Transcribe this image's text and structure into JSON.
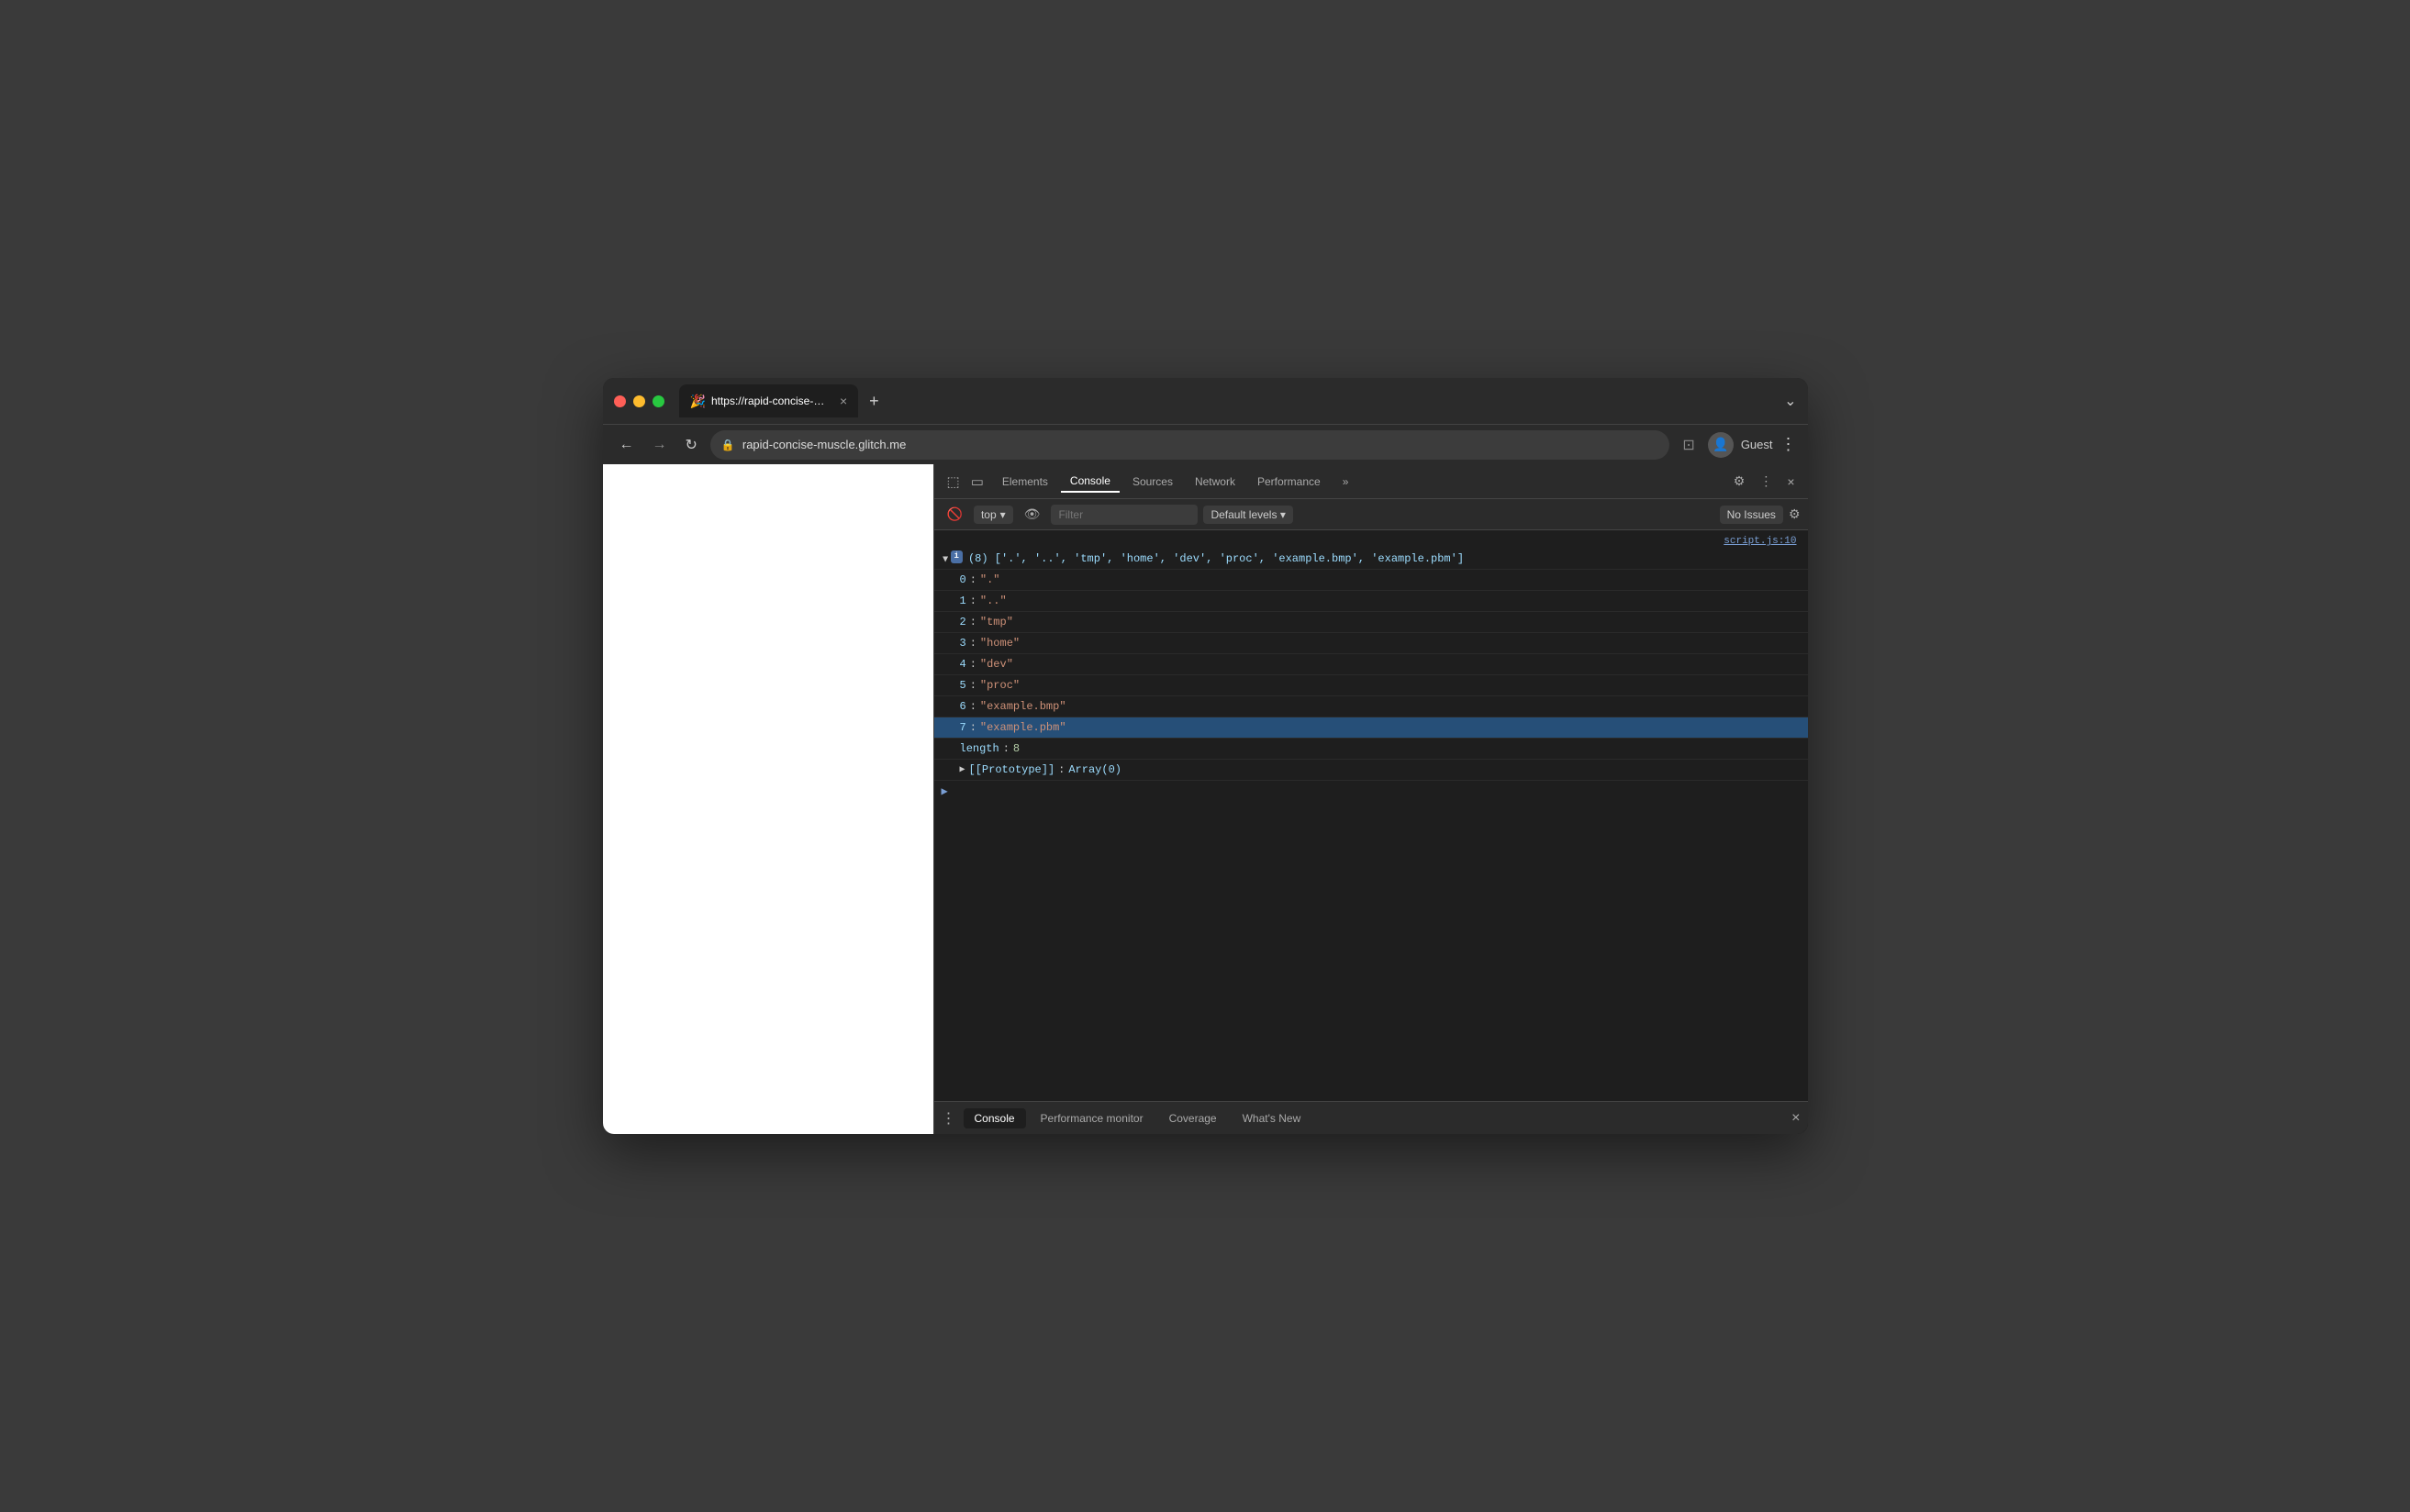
{
  "browser": {
    "tab": {
      "favicon": "🎉",
      "title": "https://rapid-concise-muscle.g...",
      "close_icon": "×"
    },
    "new_tab_icon": "+",
    "window_controls": {
      "red": "#ff5f57",
      "yellow": "#febc2e",
      "green": "#28c840"
    },
    "overflow_icon": "⌄"
  },
  "navbar": {
    "back_label": "←",
    "forward_label": "→",
    "reload_label": "↻",
    "address": "rapid-concise-muscle.glitch.me",
    "split_icon": "⊡",
    "menu_icon": "⋮",
    "profile_icon": "👤",
    "profile_label": "Guest"
  },
  "devtools": {
    "toolbar_icons": {
      "pointer_icon": "⬚",
      "mobile_icon": "▭",
      "close_icon": "×",
      "settings_icon": "⚙",
      "more_icon": "⋮"
    },
    "tabs": [
      {
        "label": "Elements",
        "active": false
      },
      {
        "label": "Console",
        "active": true
      },
      {
        "label": "Sources",
        "active": false
      },
      {
        "label": "Network",
        "active": false
      },
      {
        "label": "Performance",
        "active": false
      },
      {
        "label": "»",
        "active": false
      }
    ],
    "secondary_toolbar": {
      "clear_icon": "🚫",
      "context": "top",
      "dropdown_icon": "▾",
      "eye_icon": "👁",
      "filter_placeholder": "Filter",
      "log_levels": "Default levels",
      "log_levels_icon": "▾",
      "no_issues": "No Issues",
      "settings_icon": "⚙"
    },
    "console": {
      "source_link": "script.js:10",
      "array_preview": "(8) ['.', '..', 'tmp', 'home', 'dev', 'proc', 'example.bmp', 'example.pbm']",
      "entries": [
        {
          "index": "0",
          "value": "\".\""
        },
        {
          "index": "1",
          "value": "\"..\""
        },
        {
          "index": "2",
          "value": "\"tmp\""
        },
        {
          "index": "3",
          "value": "\"home\""
        },
        {
          "index": "4",
          "value": "\"dev\""
        },
        {
          "index": "5",
          "value": "\"proc\""
        },
        {
          "index": "6",
          "value": "\"example.bmp\""
        },
        {
          "index": "7",
          "value": "\"example.pbm\"",
          "highlighted": true
        }
      ],
      "length_label": "length",
      "length_value": "8",
      "prototype_label": "[[Prototype]]",
      "prototype_value": "Array(0)"
    },
    "bottom_tabs": [
      {
        "label": "Console",
        "active": true
      },
      {
        "label": "Performance monitor",
        "active": false
      },
      {
        "label": "Coverage",
        "active": false
      },
      {
        "label": "What's New",
        "active": false
      }
    ],
    "bottom_dots_icon": "⋮"
  }
}
